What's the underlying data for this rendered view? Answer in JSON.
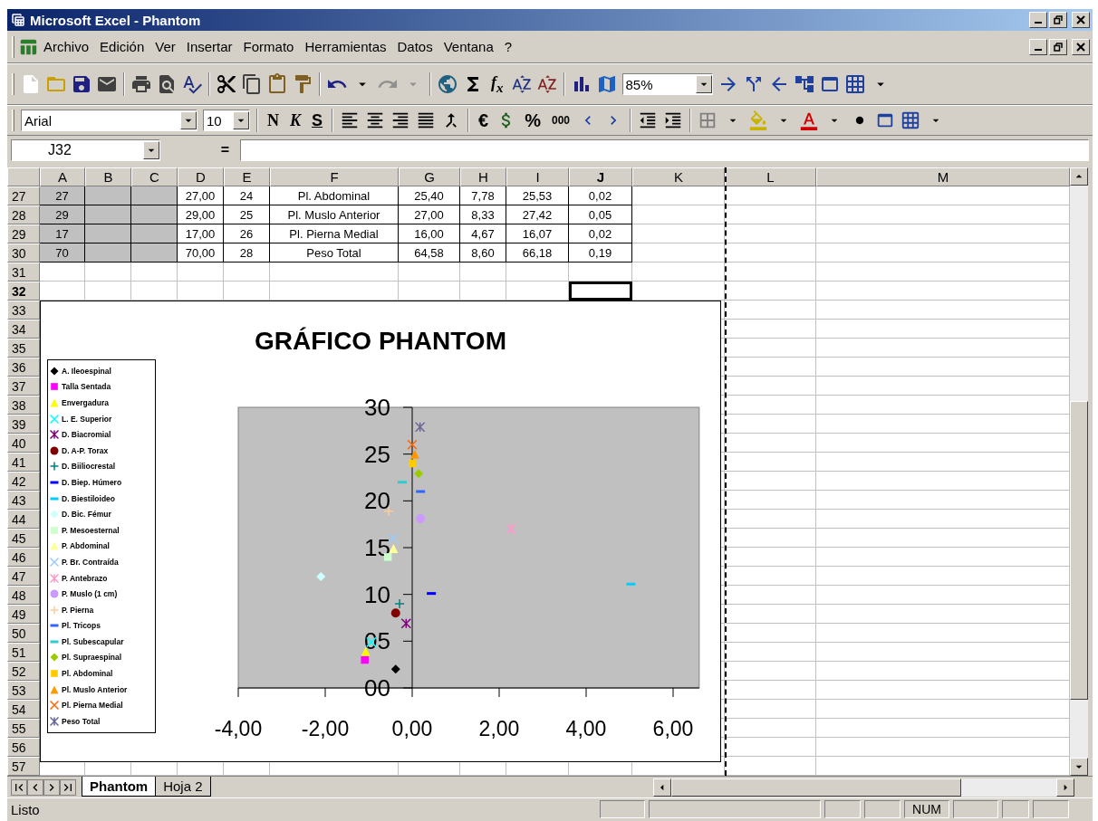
{
  "window": {
    "title": "Microsoft Excel - Phantom"
  },
  "menu": [
    "Archivo",
    "Edición",
    "Ver",
    "Insertar",
    "Formato",
    "Herramientas",
    "Datos",
    "Ventana",
    "?"
  ],
  "standard_toolbar": {
    "function_button": "f$_{x}$",
    "zoom": "85%"
  },
  "format_toolbar": {
    "font": "Arial",
    "size": "10",
    "bold": "N",
    "italic": "K",
    "underline": "S",
    "euro": "€",
    "percent": "%",
    "thousands": "000"
  },
  "formula_bar": {
    "name_box": "J32",
    "equals": "="
  },
  "sheet": {
    "columns": [
      {
        "label": "A",
        "selected": false
      },
      {
        "label": "B",
        "selected": false
      },
      {
        "label": "C",
        "selected": false
      },
      {
        "label": "D",
        "selected": false
      },
      {
        "label": "E",
        "selected": false
      },
      {
        "label": "F",
        "selected": false
      },
      {
        "label": "G",
        "selected": false
      },
      {
        "label": "H",
        "selected": false
      },
      {
        "label": "I",
        "selected": false
      },
      {
        "label": "J",
        "selected": true
      },
      {
        "label": "K",
        "selected": false
      },
      {
        "label": "L",
        "selected": false
      },
      {
        "label": "M",
        "selected": false
      }
    ],
    "rows": [
      {
        "label": "27",
        "selected": false,
        "cells": [
          {
            "text": "27",
            "shaded": true
          },
          {
            "shaded": true
          },
          {
            "shaded": true
          },
          {
            "text": "27,00"
          },
          {
            "text": "24"
          },
          {
            "text": "Pl. Abdominal"
          },
          {
            "text": "25,40"
          },
          {
            "text": "7,78"
          },
          {
            "text": "25,53"
          },
          {
            "text": "0,02"
          }
        ]
      },
      {
        "label": "28",
        "selected": false,
        "cells": [
          {
            "text": "29",
            "shaded": true
          },
          {
            "shaded": true
          },
          {
            "shaded": true
          },
          {
            "text": "29,00"
          },
          {
            "text": "25"
          },
          {
            "text": "Pl. Muslo Anterior"
          },
          {
            "text": "27,00"
          },
          {
            "text": "8,33"
          },
          {
            "text": "27,42"
          },
          {
            "text": "0,05"
          }
        ]
      },
      {
        "label": "29",
        "selected": false,
        "cells": [
          {
            "text": "17",
            "shaded": true
          },
          {
            "shaded": true
          },
          {
            "shaded": true
          },
          {
            "text": "17,00"
          },
          {
            "text": "26"
          },
          {
            "text": "Pl. Pierna Medial"
          },
          {
            "text": "16,00"
          },
          {
            "text": "4,67"
          },
          {
            "text": "16,07"
          },
          {
            "text": "0,02"
          }
        ]
      },
      {
        "label": "30",
        "selected": false,
        "cells": [
          {
            "text": "70",
            "shaded": true
          },
          {
            "shaded": true
          },
          {
            "shaded": true
          },
          {
            "text": "70,00"
          },
          {
            "text": "28"
          },
          {
            "text": "Peso Total"
          },
          {
            "text": "64,58"
          },
          {
            "text": "8,60"
          },
          {
            "text": "66,18"
          },
          {
            "text": "0,19"
          }
        ]
      },
      {
        "label": "31",
        "selected": false
      },
      {
        "label": "32",
        "selected": true
      },
      {
        "label": "33",
        "selected": false
      },
      {
        "label": "34",
        "selected": false
      },
      {
        "label": "35",
        "selected": false
      },
      {
        "label": "36",
        "selected": false
      },
      {
        "label": "37",
        "selected": false
      },
      {
        "label": "38",
        "selected": false
      },
      {
        "label": "39",
        "selected": false
      },
      {
        "label": "40",
        "selected": false
      },
      {
        "label": "41",
        "selected": false
      },
      {
        "label": "42",
        "selected": false
      },
      {
        "label": "43",
        "selected": false
      },
      {
        "label": "44",
        "selected": false
      },
      {
        "label": "45",
        "selected": false
      },
      {
        "label": "46",
        "selected": false
      },
      {
        "label": "47",
        "selected": false
      },
      {
        "label": "48",
        "selected": false
      },
      {
        "label": "49",
        "selected": false
      },
      {
        "label": "50",
        "selected": false
      },
      {
        "label": "51",
        "selected": false
      },
      {
        "label": "52",
        "selected": false
      },
      {
        "label": "53",
        "selected": false
      },
      {
        "label": "54",
        "selected": false
      },
      {
        "label": "55",
        "selected": false
      },
      {
        "label": "56",
        "selected": false
      },
      {
        "label": "57",
        "selected": false
      }
    ]
  },
  "chart": {
    "chart_data": {
      "type": "scatter",
      "title": "GRÁFICO PHANTOM",
      "legend": true,
      "xlim": [
        -4,
        6.6
      ],
      "ylim": [
        0,
        30
      ],
      "x": [
        -0.38,
        -1.09,
        -1.07,
        -0.94,
        -0.14,
        -0.38,
        -0.29,
        0.44,
        5.03,
        -2.1,
        -0.56,
        -0.43,
        -0.44,
        2.27,
        0.19,
        -0.54,
        0.19,
        -0.23,
        0.15,
        0.01,
        0.06,
        0.0,
        0.18
      ],
      "xticks": [
        {
          "value": -4,
          "label": "-4,00"
        },
        {
          "value": -2,
          "label": "-2,00"
        },
        {
          "value": 0,
          "label": "0,00"
        },
        {
          "value": 2,
          "label": "2,00"
        },
        {
          "value": 4,
          "label": "4,00"
        },
        {
          "value": 6,
          "label": "6,00"
        }
      ],
      "yticks": [
        {
          "value": 0,
          "label": "00"
        },
        {
          "value": 5,
          "label": "05"
        },
        {
          "value": 10,
          "label": "10"
        },
        {
          "value": 15,
          "label": "15"
        },
        {
          "value": 20,
          "label": "20"
        },
        {
          "value": 25,
          "label": "25"
        },
        {
          "value": 30,
          "label": "30"
        }
      ],
      "series": [
        {
          "name": "A. Ileoespinal",
          "color": "#000000",
          "values": [
            2.0,
            null,
            null,
            null,
            null,
            null,
            null,
            null,
            null,
            null,
            null,
            null,
            null,
            null,
            null,
            null,
            null,
            null,
            null,
            null,
            null,
            null,
            null
          ]
        },
        {
          "name": "Talla Sentada",
          "color": "#ff00ff",
          "values": [
            null,
            3.0,
            null,
            null,
            null,
            null,
            null,
            null,
            null,
            null,
            null,
            null,
            null,
            null,
            null,
            null,
            null,
            null,
            null,
            null,
            null,
            null,
            null
          ]
        },
        {
          "name": "Envergadura",
          "color": "#ffff00",
          "values": [
            null,
            null,
            3.9,
            null,
            null,
            null,
            null,
            null,
            null,
            null,
            null,
            null,
            null,
            null,
            null,
            null,
            null,
            null,
            null,
            null,
            null,
            null,
            null
          ]
        },
        {
          "name": "L. E. Superior",
          "color": "#00ffff",
          "values": [
            null,
            null,
            null,
            4.9,
            null,
            null,
            null,
            null,
            null,
            null,
            null,
            null,
            null,
            null,
            null,
            null,
            null,
            null,
            null,
            null,
            null,
            null,
            null
          ]
        },
        {
          "name": "D. Biacromial",
          "color": "#800080",
          "values": [
            null,
            null,
            null,
            null,
            6.9,
            null,
            null,
            null,
            null,
            null,
            null,
            null,
            null,
            null,
            null,
            null,
            null,
            null,
            null,
            null,
            null,
            null,
            null
          ]
        },
        {
          "name": "D. A-P. Torax",
          "color": "#800000",
          "values": [
            null,
            null,
            null,
            null,
            null,
            8.0,
            null,
            null,
            null,
            null,
            null,
            null,
            null,
            null,
            null,
            null,
            null,
            null,
            null,
            null,
            null,
            null,
            null
          ]
        },
        {
          "name": "D. Biiliocrestal",
          "color": "#008080",
          "values": [
            null,
            null,
            null,
            null,
            null,
            null,
            9.0,
            null,
            null,
            null,
            null,
            null,
            null,
            null,
            null,
            null,
            null,
            null,
            null,
            null,
            null,
            null,
            null
          ]
        },
        {
          "name": "D. Biep. Húmero",
          "color": "#0000ff",
          "values": [
            null,
            null,
            null,
            null,
            null,
            null,
            null,
            10.1,
            null,
            null,
            null,
            null,
            null,
            null,
            null,
            null,
            null,
            null,
            null,
            null,
            null,
            null,
            null
          ]
        },
        {
          "name": "D. Biestiloideo",
          "color": "#00ccff",
          "values": [
            null,
            null,
            null,
            null,
            null,
            null,
            null,
            null,
            11.1,
            null,
            null,
            null,
            null,
            null,
            null,
            null,
            null,
            null,
            null,
            null,
            null,
            null,
            null
          ]
        },
        {
          "name": "D. Bic. Fémur",
          "color": "#ccffff",
          "values": [
            null,
            null,
            null,
            null,
            null,
            null,
            null,
            null,
            null,
            11.9,
            null,
            null,
            null,
            null,
            null,
            null,
            null,
            null,
            null,
            null,
            null,
            null,
            null
          ]
        },
        {
          "name": "P. Mesoesternal",
          "color": "#ccffcc",
          "values": [
            null,
            null,
            null,
            null,
            null,
            null,
            null,
            null,
            null,
            null,
            14.0,
            null,
            null,
            null,
            null,
            null,
            null,
            null,
            null,
            null,
            null,
            null,
            null
          ]
        },
        {
          "name": "P. Abdominal",
          "color": "#ffff99",
          "values": [
            null,
            null,
            null,
            null,
            null,
            null,
            null,
            null,
            null,
            null,
            null,
            14.9,
            null,
            null,
            null,
            null,
            null,
            null,
            null,
            null,
            null,
            null,
            null
          ]
        },
        {
          "name": "P. Br. Contraída",
          "color": "#99ccff",
          "values": [
            null,
            null,
            null,
            null,
            null,
            null,
            null,
            null,
            null,
            null,
            null,
            null,
            16.0,
            null,
            null,
            null,
            null,
            null,
            null,
            null,
            null,
            null,
            null
          ]
        },
        {
          "name": "P. Antebrazo",
          "color": "#ff99cc",
          "values": [
            null,
            null,
            null,
            null,
            null,
            null,
            null,
            null,
            null,
            null,
            null,
            null,
            null,
            17.0,
            null,
            null,
            null,
            null,
            null,
            null,
            null,
            null,
            null
          ]
        },
        {
          "name": "P. Muslo (1 cm)",
          "color": "#cc99ff",
          "values": [
            null,
            null,
            null,
            null,
            null,
            null,
            null,
            null,
            null,
            null,
            null,
            null,
            null,
            null,
            18.1,
            null,
            null,
            null,
            null,
            null,
            null,
            null,
            null
          ]
        },
        {
          "name": "P. Pierna",
          "color": "#ffcc99",
          "values": [
            null,
            null,
            null,
            null,
            null,
            null,
            null,
            null,
            null,
            null,
            null,
            null,
            null,
            null,
            null,
            18.9,
            null,
            null,
            null,
            null,
            null,
            null,
            null
          ]
        },
        {
          "name": "Pl. Tricops",
          "color": "#3366ff",
          "values": [
            null,
            null,
            null,
            null,
            null,
            null,
            null,
            null,
            null,
            null,
            null,
            null,
            null,
            null,
            null,
            null,
            21.0,
            null,
            null,
            null,
            null,
            null,
            null
          ]
        },
        {
          "name": "Pl. Subescapular",
          "color": "#33cccc",
          "values": [
            null,
            null,
            null,
            null,
            null,
            null,
            null,
            null,
            null,
            null,
            null,
            null,
            null,
            null,
            null,
            null,
            null,
            22.0,
            null,
            null,
            null,
            null,
            null
          ]
        },
        {
          "name": "Pl. Supraespinal",
          "color": "#99cc00",
          "values": [
            null,
            null,
            null,
            null,
            null,
            null,
            null,
            null,
            null,
            null,
            null,
            null,
            null,
            null,
            null,
            null,
            null,
            null,
            22.9,
            null,
            null,
            null,
            null
          ]
        },
        {
          "name": "Pl. Abdominal",
          "color": "#ffcc00",
          "values": [
            null,
            null,
            null,
            null,
            null,
            null,
            null,
            null,
            null,
            null,
            null,
            null,
            null,
            null,
            null,
            null,
            null,
            null,
            null,
            24.0,
            null,
            null,
            null
          ]
        },
        {
          "name": "Pl. Muslo Anterior",
          "color": "#ff9900",
          "values": [
            null,
            null,
            null,
            null,
            null,
            null,
            null,
            null,
            null,
            null,
            null,
            null,
            null,
            null,
            null,
            null,
            null,
            null,
            null,
            null,
            25.0,
            null,
            null
          ]
        },
        {
          "name": "Pl. Pierna Medial",
          "color": "#ff6600",
          "values": [
            null,
            null,
            null,
            null,
            null,
            null,
            null,
            null,
            null,
            null,
            null,
            null,
            null,
            null,
            null,
            null,
            null,
            null,
            null,
            null,
            null,
            26.0,
            null
          ]
        },
        {
          "name": "Peso Total",
          "color": "#666699",
          "values": [
            null,
            null,
            null,
            null,
            null,
            null,
            null,
            null,
            null,
            null,
            null,
            null,
            null,
            null,
            null,
            null,
            null,
            null,
            null,
            null,
            null,
            null,
            27.9
          ]
        }
      ]
    }
  },
  "sheet_tabs": [
    {
      "label": "Phantom",
      "selected": true
    },
    {
      "label": "Hoja 2",
      "selected": false
    }
  ],
  "status_bar": {
    "message": "Listo",
    "indicator": "NUM"
  }
}
